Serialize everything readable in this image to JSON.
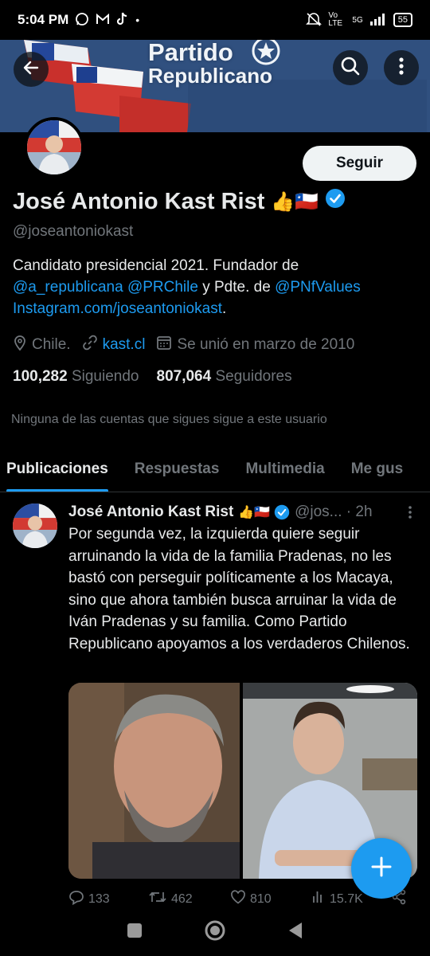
{
  "status_bar": {
    "time": "5:04 PM",
    "icons_left": [
      "whatsapp-icon",
      "gmail-icon",
      "tiktok-icon",
      "dot-icon"
    ],
    "network": "Vo LTE",
    "signal": "5G",
    "battery": "55"
  },
  "banner": {
    "title_line1": "Partido",
    "title_line2": "Republicano"
  },
  "profile": {
    "follow_label": "Seguir",
    "name": "José Antonio Kast Rist",
    "name_emojis": "👍🇨🇱",
    "handle": "@joseantoniokast",
    "bio": {
      "text1": "Candidato presidencial 2021. Fundador de ",
      "link1": "@a_republicana",
      "text2": " ",
      "link2": "@PRChile",
      "text3": " y Pdte. de ",
      "link3": "@PNfValues",
      "link4": "Instagram.com/joseantoniokast",
      "text4": "."
    },
    "location": "Chile.",
    "website": "kast.cl",
    "joined": "Se unió en marzo de 2010",
    "following_count": "100,282",
    "following_label": "Siguiendo",
    "followers_count": "807,064",
    "followers_label": "Seguidores",
    "no_follow_text": "Ninguna de las cuentas que sigues sigue a este usuario"
  },
  "tabs": [
    {
      "label": "Publicaciones",
      "active": true
    },
    {
      "label": "Respuestas",
      "active": false
    },
    {
      "label": "Multimedia",
      "active": false
    },
    {
      "label": "Me gus",
      "active": false
    }
  ],
  "tweet": {
    "author": "José Antonio Kast Rist",
    "emojis": "👍🇨🇱",
    "handle_time": "@jos... · 2h",
    "text": "Por segunda vez, la izquierda quiere seguir arruinando la vida de la familia Pradenas, no les bastó con perseguir políticamente a los Macaya, sino que ahora también busca arruinar la vida de Iván Pradenas y su familia. Como Partido Republicano apoyamos a los verdaderos Chilenos.",
    "replies": "133",
    "reposts": "462",
    "likes": "810",
    "views": "15.7K"
  },
  "colors": {
    "accent": "#1d9bf0",
    "background": "#000000",
    "text": "#e7e9ea",
    "muted": "#71767b"
  }
}
